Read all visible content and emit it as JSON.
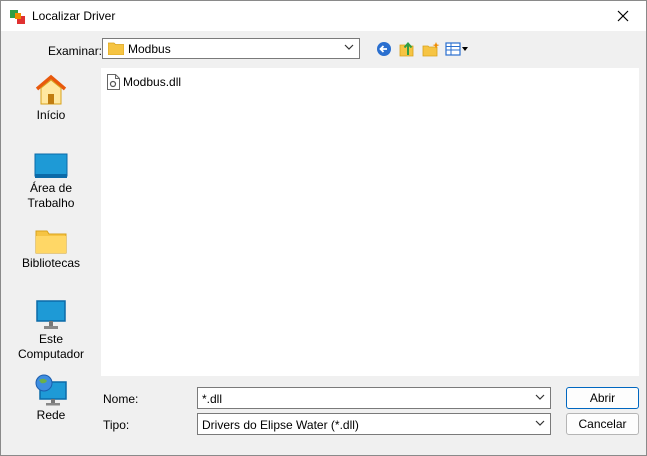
{
  "window": {
    "title": "Localizar Driver"
  },
  "toolbar": {
    "look_in_label": "Examinar:",
    "look_in_value": "Modbus"
  },
  "places": [
    {
      "label": "Início",
      "icon": "home-icon"
    },
    {
      "label": "Área de Trabalho",
      "icon": "desktop-icon"
    },
    {
      "label": "Bibliotecas",
      "icon": "libraries-folder-icon"
    },
    {
      "label": "Este Computador",
      "icon": "computer-icon"
    },
    {
      "label": "Rede",
      "icon": "network-icon"
    }
  ],
  "files": [
    {
      "name": "Modbus.dll",
      "icon": "dll-file-icon"
    }
  ],
  "form": {
    "name_label": "Nome:",
    "name_value": "*.dll",
    "type_label": "Tipo:",
    "type_value": "Drivers do Elipse Water (*.dll)"
  },
  "buttons": {
    "open": "Abrir",
    "cancel": "Cancelar"
  },
  "colors": {
    "accent": "#0067c0",
    "folder": "#f6c443",
    "screen": "#1e9ad6"
  }
}
